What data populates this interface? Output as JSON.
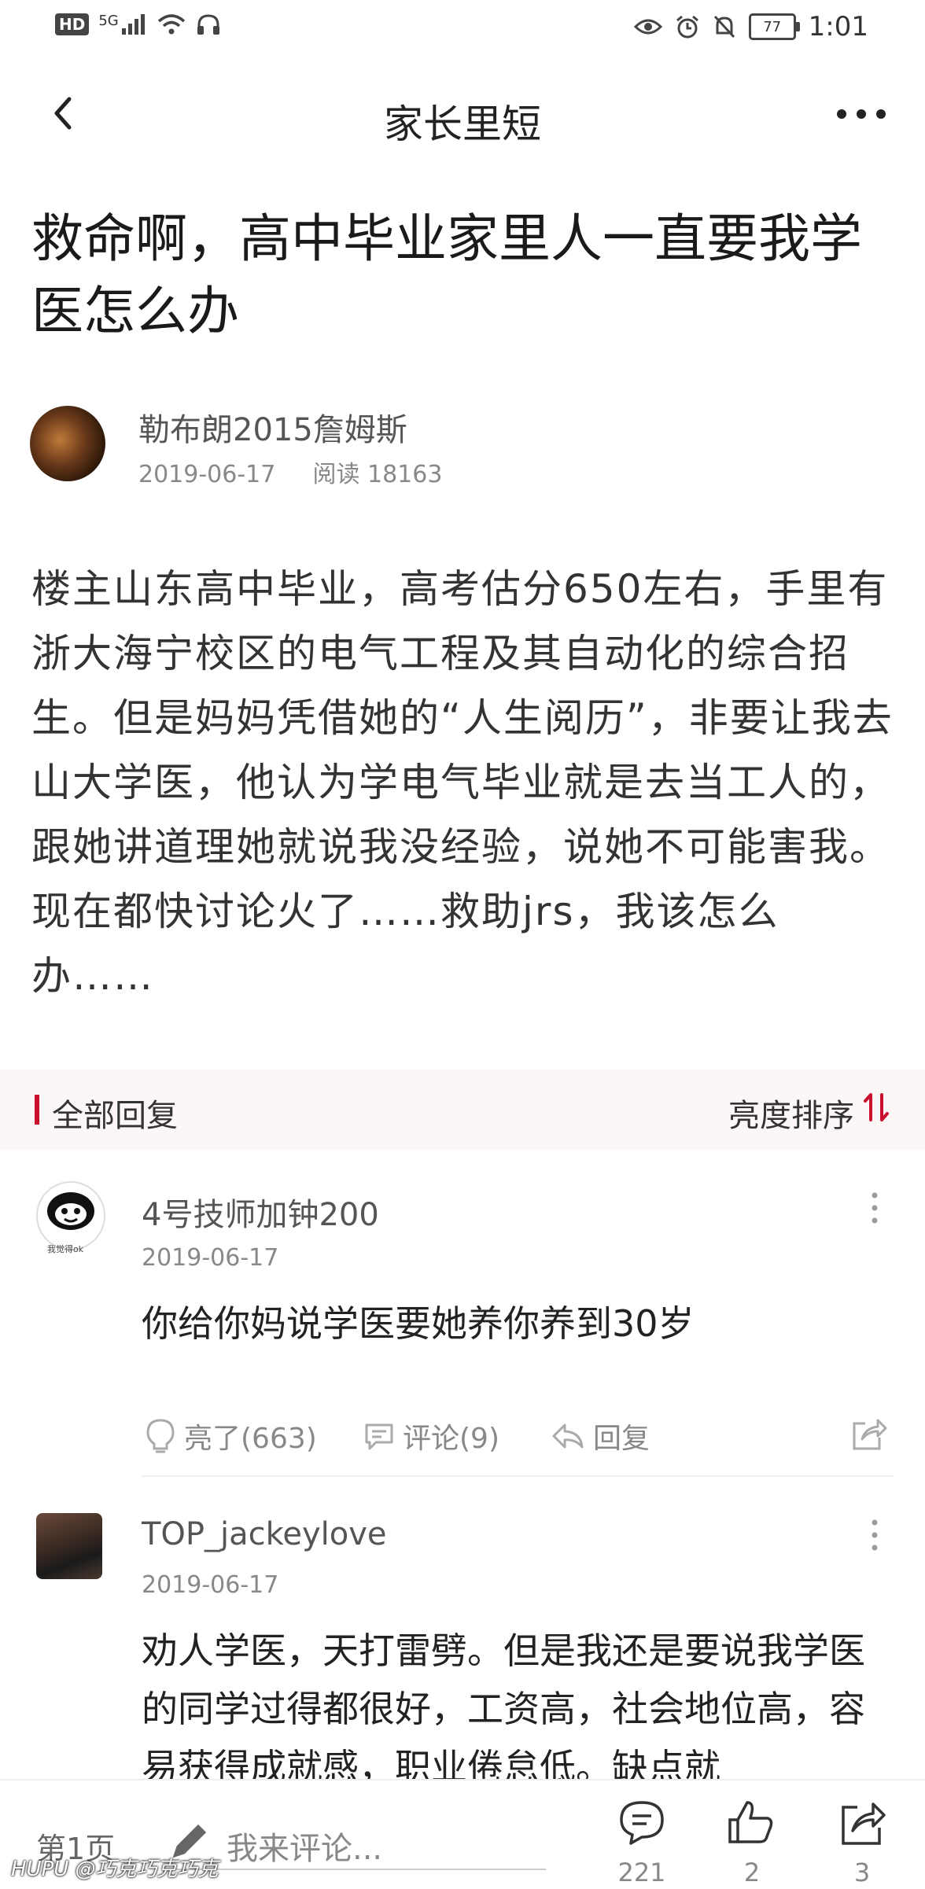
{
  "status_bar": {
    "hd": "HD",
    "signal": "5G",
    "battery": "77",
    "time": "1:01"
  },
  "nav": {
    "title": "家长里短"
  },
  "post": {
    "title": "救命啊，高中毕业家里人一直要我学医怎么办",
    "author": "勒布朗2015詹姆斯",
    "date": "2019-06-17",
    "reads": "阅读 18163",
    "body": "楼主山东高中毕业，高考估分650左右，手里有浙大海宁校区的电气工程及其自动化的综合招生。但是妈妈凭借她的“人生阅历”，非要让我去山大学医，他认为学电气毕业就是去当工人的，跟她讲道理她就说我没经验，说她不可能害我。现在都快讨论火了……救助jrs，我该怎么办……"
  },
  "replies_header": {
    "label": "全部回复",
    "sort": "亮度排序"
  },
  "comments": [
    {
      "name": "4号技师加钟200",
      "date": "2019-06-17",
      "text": "你给你妈说学医要她养你养到30岁",
      "avatar_caption": "我觉得ok",
      "light": "亮了(663)",
      "comment": "评论(9)",
      "reply": "回复"
    },
    {
      "name": "TOP_jackeylove",
      "date": "2019-06-17",
      "text": "劝人学医，天打雷劈。但是我还是要说我学医的同学过得都很好，工资高，社会地位高，容易获得成就感，职业倦怠低。缺点就"
    }
  ],
  "bottom_bar": {
    "page": "第1页",
    "input_placeholder": "我来评论...",
    "comments_count": "221",
    "likes_count": "2",
    "shares_count": "3"
  },
  "watermark": "HUPU @巧克巧克巧克",
  "colors": {
    "accent": "#c8102e",
    "header_bg": "#fcf6f7"
  }
}
